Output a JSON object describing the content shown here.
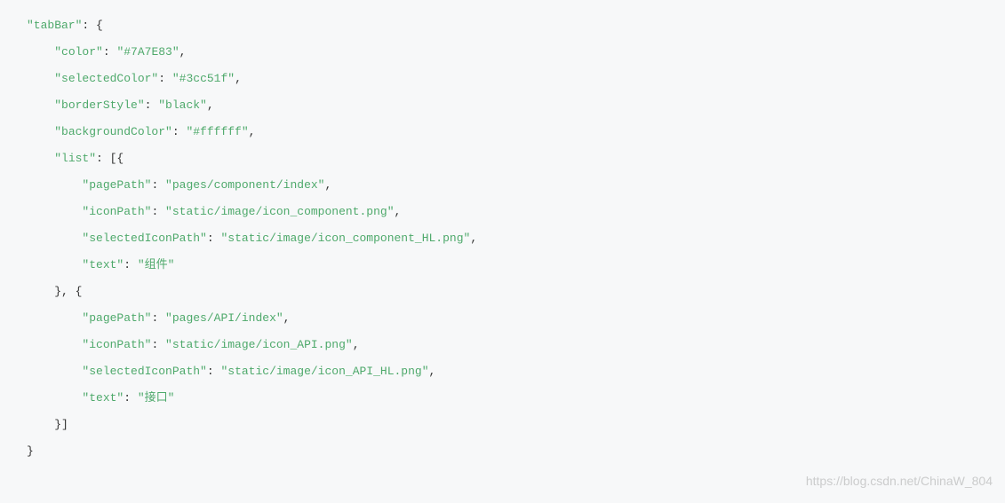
{
  "code": {
    "tabBar_key": "\"tabBar\"",
    "color_key": "\"color\"",
    "color_val": "\"#7A7E83\"",
    "selectedColor_key": "\"selectedColor\"",
    "selectedColor_val": "\"#3cc51f\"",
    "borderStyle_key": "\"borderStyle\"",
    "borderStyle_val": "\"black\"",
    "backgroundColor_key": "\"backgroundColor\"",
    "backgroundColor_val": "\"#ffffff\"",
    "list_key": "\"list\"",
    "pagePath_key": "\"pagePath\"",
    "iconPath_key": "\"iconPath\"",
    "selectedIconPath_key": "\"selectedIconPath\"",
    "text_key": "\"text\"",
    "item1_pagePath": "\"pages/component/index\"",
    "item1_iconPath": "\"static/image/icon_component.png\"",
    "item1_selectedIconPath": "\"static/image/icon_component_HL.png\"",
    "item1_text": "\"组件\"",
    "item2_pagePath": "\"pages/API/index\"",
    "item2_iconPath": "\"static/image/icon_API.png\"",
    "item2_selectedIconPath": "\"static/image/icon_API_HL.png\"",
    "item2_text": "\"接口\""
  },
  "watermark": "https://blog.csdn.net/ChinaW_804"
}
